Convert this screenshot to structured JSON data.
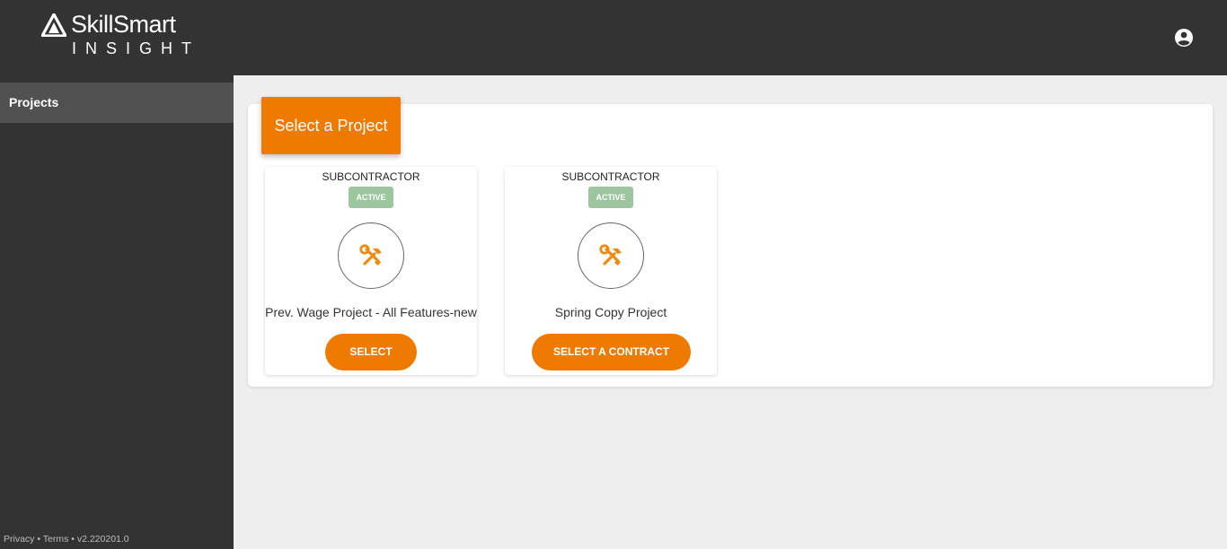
{
  "header": {
    "logo_text": "SkillSmart",
    "logo_subtext": "INSIGHT",
    "account_icon": "account-circle-icon"
  },
  "sidebar": {
    "items": [
      {
        "label": "Projects"
      }
    ],
    "footer": "Privacy • Terms • v2.220201.0"
  },
  "main": {
    "title": "Select a Project",
    "projects": [
      {
        "role": "SUBCONTRACTOR",
        "status": "ACTIVE",
        "icon": "tools-icon",
        "name": "Prev. Wage Project - All Features-new",
        "button_label": "SELECT"
      },
      {
        "role": "SUBCONTRACTOR",
        "status": "ACTIVE",
        "icon": "tools-icon",
        "name": "Spring Copy Project",
        "button_label": "SELECT A CONTRACT"
      }
    ]
  },
  "colors": {
    "accent": "#ef7a00",
    "header_bg": "#333333",
    "status_active": "#9bc69e",
    "page_bg": "#eeeeee"
  }
}
